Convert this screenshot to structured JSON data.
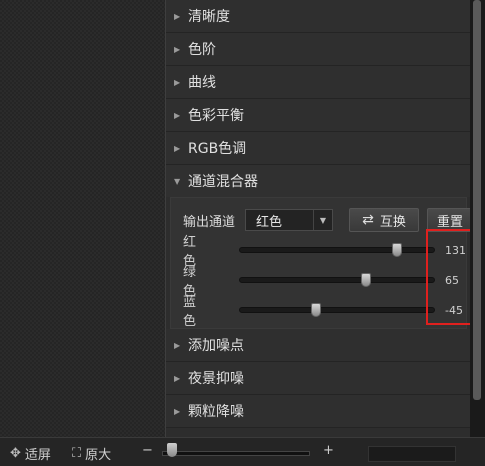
{
  "sections_before": [
    {
      "label": "清晰度"
    },
    {
      "label": "色阶"
    },
    {
      "label": "曲线"
    },
    {
      "label": "色彩平衡"
    },
    {
      "label": "RGB色调"
    }
  ],
  "expanded_section": {
    "label": "通道混合器",
    "output_label": "输出通道",
    "output_value": "红色",
    "swap_label": "互换",
    "reset_label": "重置",
    "channels": [
      {
        "label": "红色",
        "value": "131",
        "level": 0.81
      },
      {
        "label": "绿色",
        "value": "65",
        "level": 0.65
      },
      {
        "label": "蓝色",
        "value": "-45",
        "level": 0.39
      }
    ]
  },
  "sections_after": [
    {
      "label": "添加噪点"
    },
    {
      "label": "夜景抑噪"
    },
    {
      "label": "颗粒降噪"
    }
  ],
  "bottom": {
    "fit_label": "适屏",
    "actual_label": "原大",
    "minus": "−",
    "plus": "+"
  },
  "colors": {
    "highlight": "#e0201e",
    "accent": "#d8d8d8"
  }
}
